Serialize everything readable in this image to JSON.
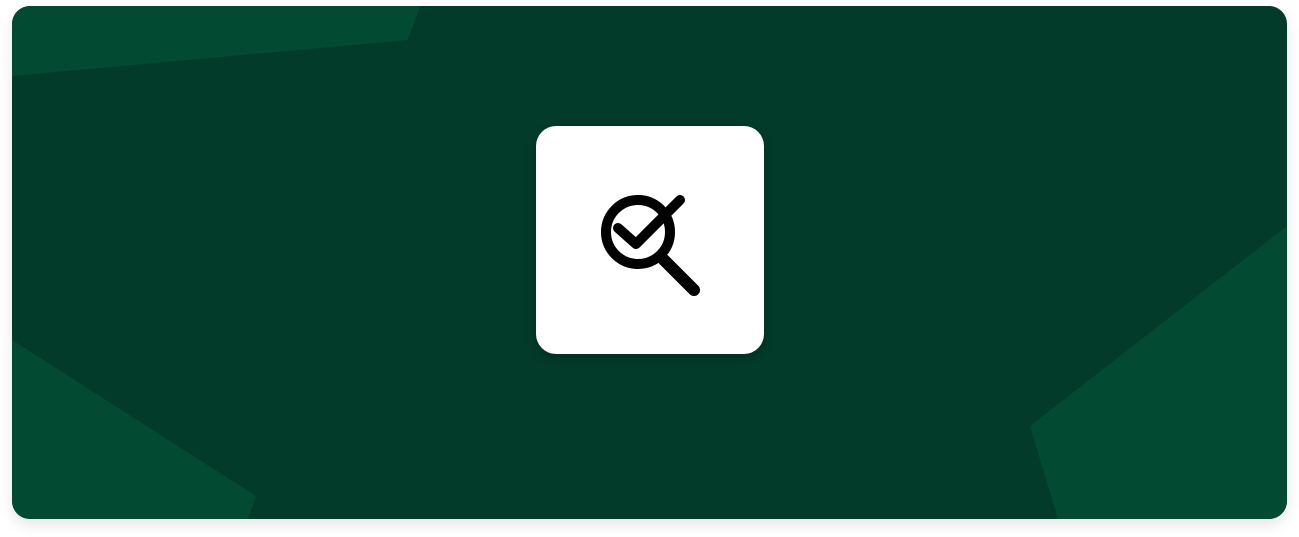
{
  "colors": {
    "card_background": "#033b2a",
    "accent_shape": "#024a32",
    "tile_background": "#ffffff",
    "icon_color": "#000000"
  },
  "icon": {
    "name": "search-check-icon"
  }
}
